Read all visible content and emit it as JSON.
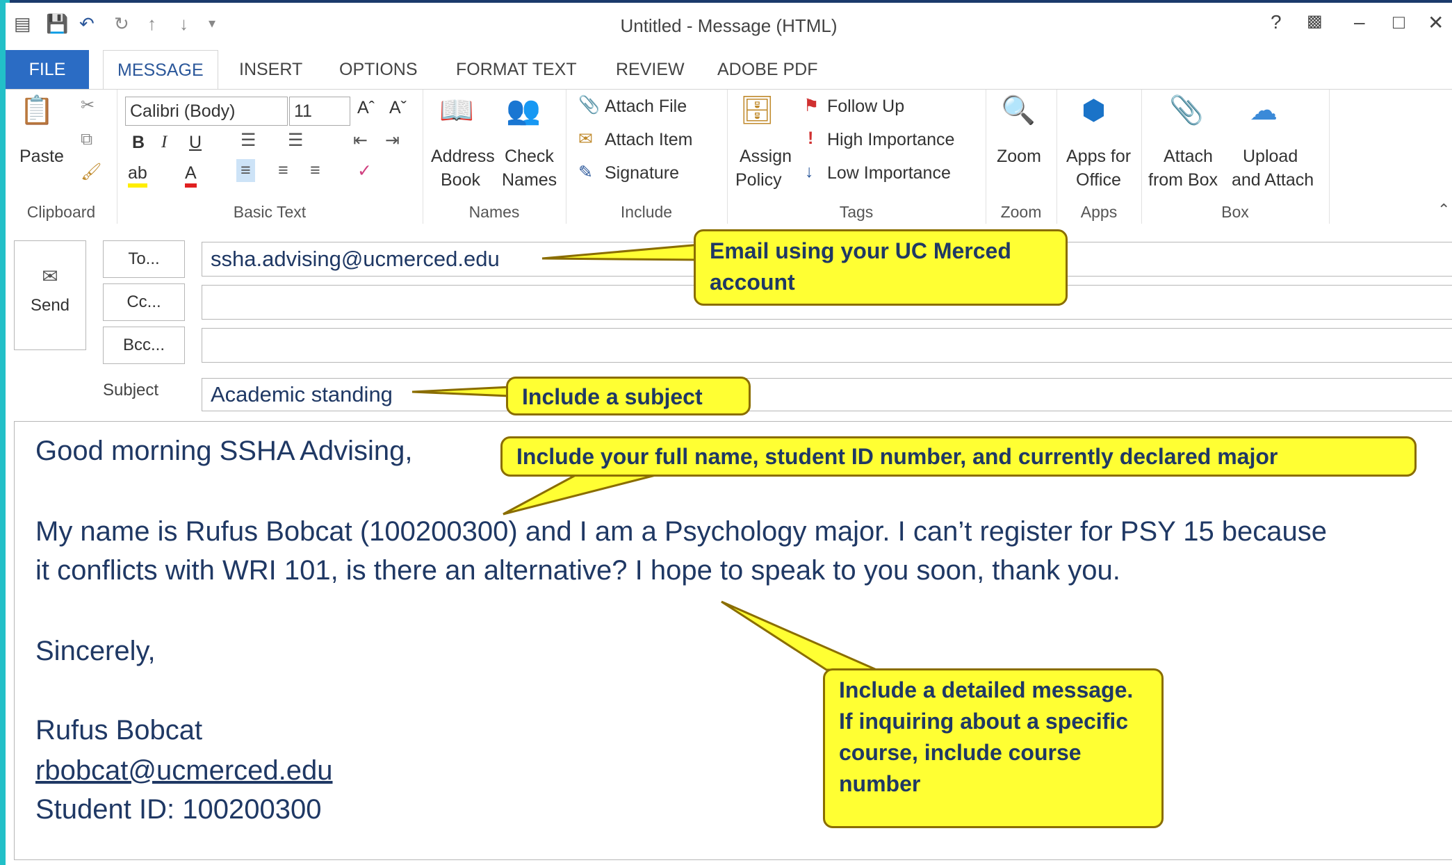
{
  "window": {
    "title": "Untitled - Message (HTML)",
    "help": "?",
    "controls": [
      "–",
      "□",
      "✕"
    ]
  },
  "tabs": [
    "FILE",
    "MESSAGE",
    "INSERT",
    "OPTIONS",
    "FORMAT TEXT",
    "REVIEW",
    "ADOBE PDF"
  ],
  "ribbon": {
    "clipboard": {
      "label": "Clipboard",
      "paste": "Paste"
    },
    "basic_text": {
      "label": "Basic Text",
      "font": "Calibri (Body)",
      "size": "11",
      "bold": "B",
      "italic": "I",
      "underline": "U",
      "grow": "Aˆ",
      "shrink": "Aˇ",
      "font_color": "A"
    },
    "names": {
      "label": "Names",
      "address_book_1": "Address",
      "address_book_2": "Book",
      "check_names_1": "Check",
      "check_names_2": "Names"
    },
    "include": {
      "label": "Include",
      "attach_file": "Attach File",
      "attach_item": "Attach Item",
      "signature": "Signature"
    },
    "tags": {
      "label": "Tags",
      "assign_1": "Assign",
      "assign_2": "Policy",
      "follow_up": "Follow Up",
      "high": "High Importance",
      "low": "Low Importance"
    },
    "zoom": {
      "label": "Zoom",
      "button": "Zoom"
    },
    "apps": {
      "label": "Apps",
      "btn_1": "Apps for",
      "btn_2": "Office"
    },
    "box": {
      "label": "Box",
      "attach_1": "Attach",
      "attach_2": "from Box",
      "upload_1": "Upload",
      "upload_2": "and Attach"
    }
  },
  "compose": {
    "send": "Send",
    "to_btn": "To...",
    "cc_btn": "Cc...",
    "bcc_btn": "Bcc...",
    "subject_label": "Subject",
    "to_value": "ssha.advising@ucmerced.edu",
    "cc_value": "",
    "bcc_value": "",
    "subject_value": "Academic standing"
  },
  "body": {
    "greeting": "Good morning SSHA Advising,",
    "line1": "My name is Rufus Bobcat (100200300) and I am a Psychology major. I can’t register for PSY 15 because",
    "line2": "it conflicts with WRI 101, is there an alternative? I hope to speak to you soon, thank you.",
    "closing": "Sincerely,",
    "sig_name": "Rufus Bobcat",
    "sig_email": "rbobcat@ucmerced.edu",
    "sig_id": "Student ID: 100200300"
  },
  "callouts": {
    "email": "Email using your UC Merced account",
    "subject": "Include a subject",
    "details": "Include your full name, student ID number, and currently declared major",
    "message": "Include a detailed message. If inquiring about a specific course, include course number"
  },
  "colors": {
    "accent": "#2b579a",
    "callout": "#ffff33",
    "text": "#1f3864"
  }
}
